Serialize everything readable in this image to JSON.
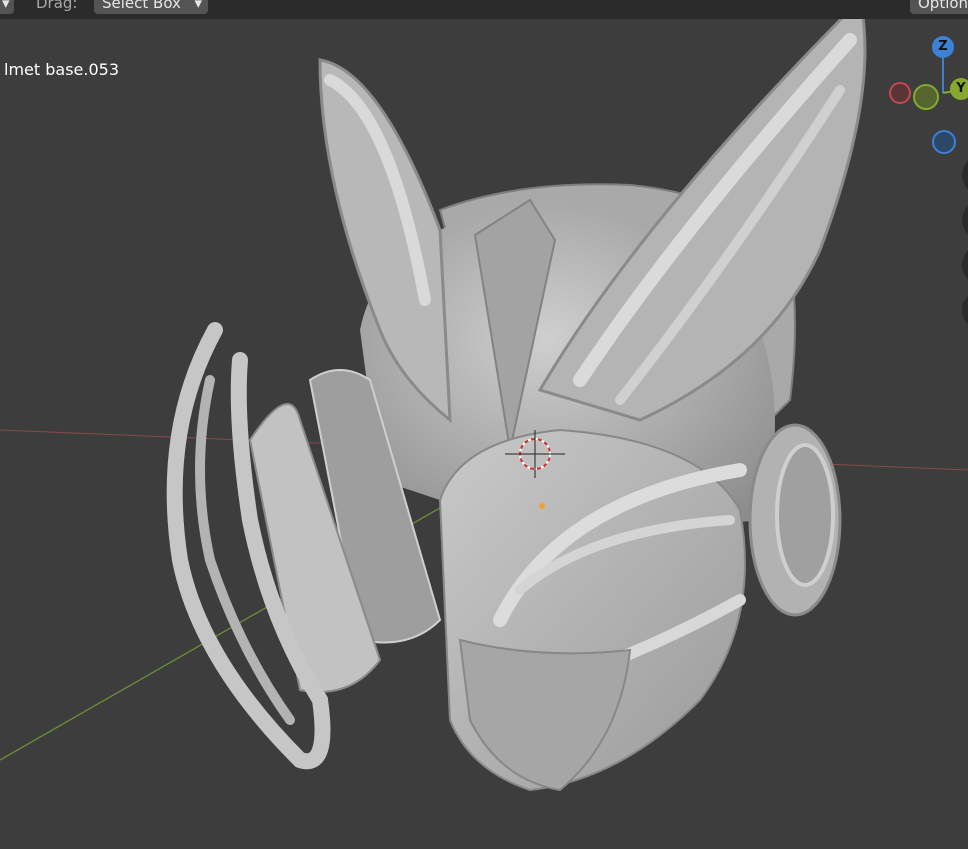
{
  "header": {
    "drag_label": "Drag:",
    "select_mode": "Select Box",
    "options_label": "Options"
  },
  "viewport": {
    "object_name": "lmet base.053",
    "background_color": "#3d3d3d"
  },
  "gizmo": {
    "z_label": "Z",
    "y_label": "Y",
    "x_color": "#c8464f",
    "y_color": "#86a82f",
    "z_color": "#3b82d6"
  },
  "model": {
    "name": "helmet",
    "color": "#bdbdbd"
  }
}
